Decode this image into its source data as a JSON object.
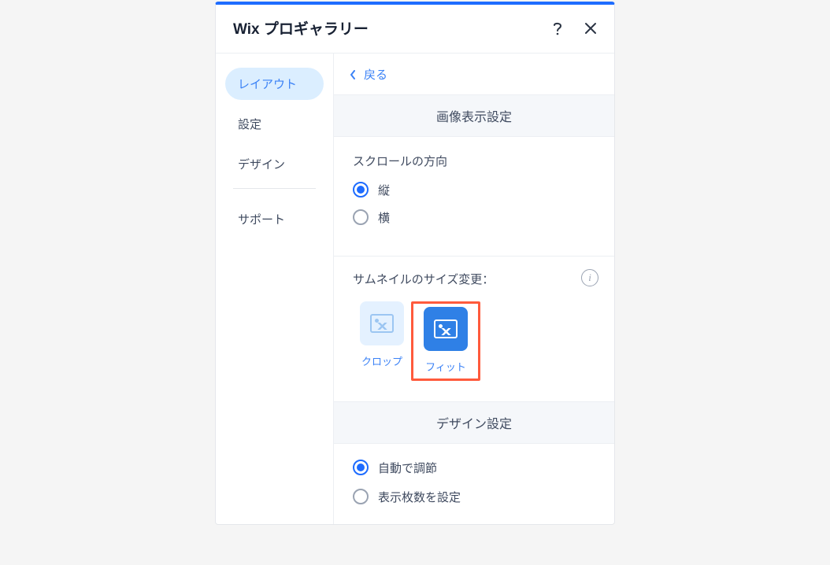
{
  "header": {
    "title": "Wix プロギャラリー"
  },
  "sidebar": {
    "items": [
      {
        "label": "レイアウト",
        "active": true
      },
      {
        "label": "設定",
        "active": false
      },
      {
        "label": "デザイン",
        "active": false
      }
    ],
    "support_label": "サポート"
  },
  "content": {
    "back_label": "戻る",
    "section_image_display": {
      "title": "画像表示設定",
      "scroll_direction_label": "スクロールの方向",
      "options": [
        {
          "label": "縦",
          "selected": true
        },
        {
          "label": "横",
          "selected": false
        }
      ]
    },
    "section_thumbnail": {
      "label": "サムネイルのサイズ変更：",
      "options": [
        {
          "label": "クロップ",
          "selected": false
        },
        {
          "label": "フィット",
          "selected": true
        }
      ]
    },
    "section_design": {
      "title": "デザイン設定",
      "options": [
        {
          "label": "自動で調節",
          "selected": true
        },
        {
          "label": "表示枚数を設定",
          "selected": false
        }
      ]
    }
  }
}
